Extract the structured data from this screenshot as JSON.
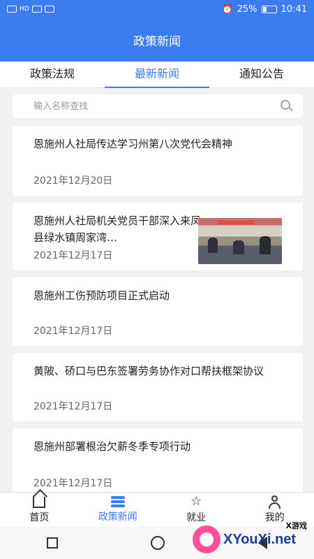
{
  "status_bar": {
    "signal_left": "HD",
    "battery_percent": "25%",
    "time": "10:41"
  },
  "header": {
    "title": "政策新闻"
  },
  "tabs": [
    {
      "label": "政策法规",
      "active": false
    },
    {
      "label": "最新新闻",
      "active": true
    },
    {
      "label": "通知公告",
      "active": false
    }
  ],
  "search": {
    "placeholder": "输入名称查找",
    "value": ""
  },
  "news": [
    {
      "title": "恩施州人社局传达学习州第八次党代会精神",
      "date": "2021年12月20日",
      "has_image": false
    },
    {
      "title": "恩施州人社局机关党员干部深入来凤县绿水镇周家湾…",
      "date": "2021年12月17日",
      "has_image": true
    },
    {
      "title": "恩施州工伤预防项目正式启动",
      "date": "2021年12月17日",
      "has_image": false
    },
    {
      "title": "黄陂、硚口与巴东签署劳务协作对口帮扶框架协议",
      "date": "2021年12月17日",
      "has_image": false
    },
    {
      "title": "恩施州部署根治欠薪冬季专项行动",
      "date": "2021年12月17日",
      "has_image": false
    }
  ],
  "bottom_nav": [
    {
      "label": "首页",
      "icon": "home-icon",
      "active": false
    },
    {
      "label": "政策新闻",
      "icon": "news-icon",
      "active": true
    },
    {
      "label": "就业",
      "icon": "star-icon",
      "active": false
    },
    {
      "label": "我的",
      "icon": "user-icon",
      "active": false
    }
  ],
  "watermark": {
    "brand": "XYouXi.net",
    "tag": "X游戏"
  },
  "colors": {
    "primary": "#3b7cf0",
    "background": "#f1f1f1"
  }
}
